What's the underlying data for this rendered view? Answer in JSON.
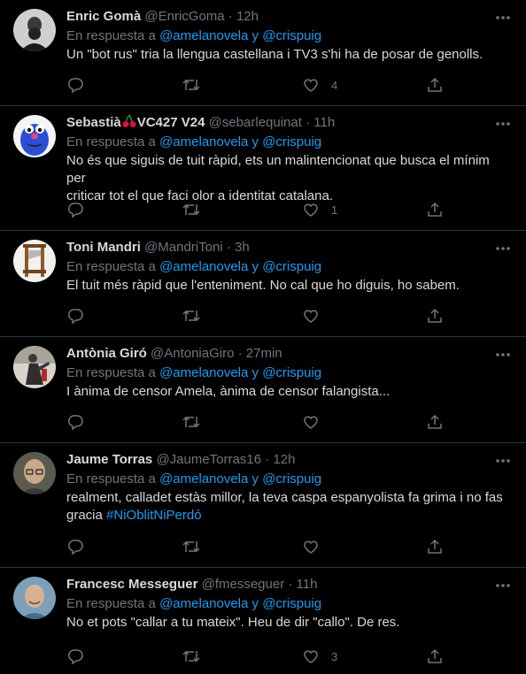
{
  "reply_prefix": "En respuesta a",
  "reply_mentions": "@amelanovela y @crispuig",
  "separator": "·",
  "tweets": [
    {
      "name": "Enric Gomà",
      "handle": "@EnricGoma",
      "time": "12h",
      "lines": [
        "Un \"bot rus\" tria la llengua castellana i TV3 s'hi ha de posar de genolls."
      ],
      "likes": "4",
      "avatar": "bearded-man-portrait"
    },
    {
      "name": "Sebastià",
      "name_suffix": "VC427 V24",
      "name_emoji": "cherries",
      "handle": "@sebarlequinat",
      "time": "11h",
      "lines": [
        "No és que siguis de tuit ràpid, ets un malintencionat que busca el mínim per",
        "criticar tot el que faci olor a identitat catalana."
      ],
      "likes": "1",
      "avatar": "blue-puppet-monster"
    },
    {
      "name": "Toni Mandri",
      "handle": "@MandriToni",
      "time": "3h",
      "lines": [
        "El tuit més ràpid que l'enteniment. No cal que ho diguis, ho sabem."
      ],
      "likes": "",
      "avatar": "guillotine"
    },
    {
      "name": "Antònia Giró",
      "handle": "@AntoniaGiro",
      "time": "27min",
      "lines": [
        "I ànima de censor Amela, ànima de censor falangista..."
      ],
      "likes": "",
      "avatar": "statue"
    },
    {
      "name": "Jaume Torras",
      "handle": "@JaumeTorras16",
      "time": "12h",
      "lines": [
        "realment, calladet estàs millor, la teva caspa espanyolista fa grima i no fas"
      ],
      "line2_prefix": "gracia",
      "hashtag": "#NiOblitNiPerdó",
      "likes": "",
      "avatar": "man-with-glasses"
    },
    {
      "name": "Francesc Messeguer",
      "handle": "@fmesseguer",
      "time": "11h",
      "lines": [
        "No et pots \"callar a tu mateix\". Heu de dir \"callo\". De res."
      ],
      "likes": "3",
      "avatar": "smiling-grey-haired-man"
    }
  ],
  "colors": {
    "background": "#000000",
    "text": "#d9d9d9",
    "secondary": "#6e767d",
    "link": "#1d9bf0",
    "divider": "#2f3336"
  }
}
